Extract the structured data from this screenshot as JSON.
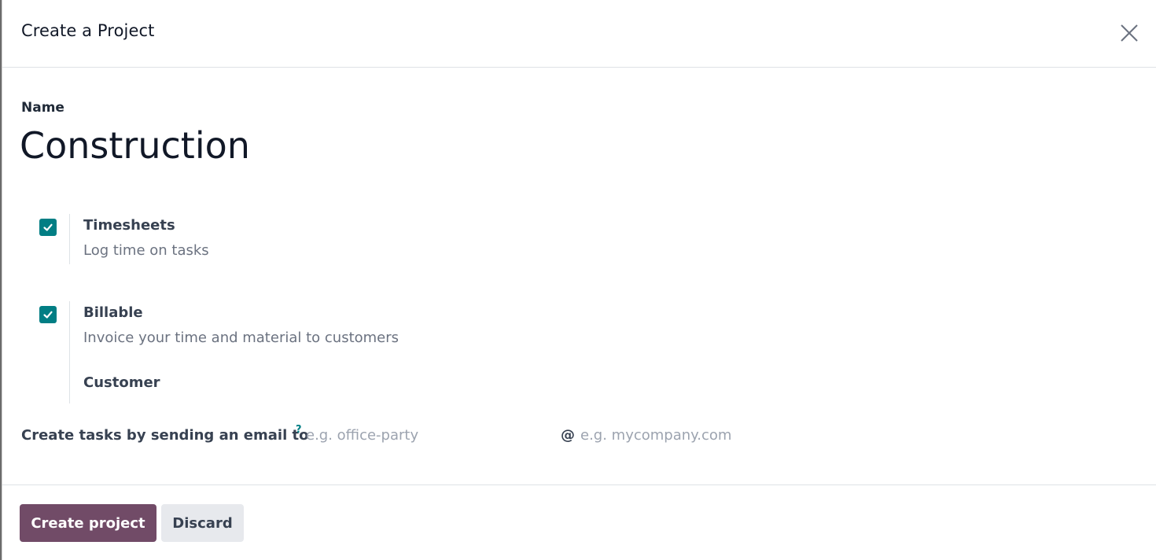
{
  "dialog": {
    "title": "Create a Project",
    "close_icon": "close-icon"
  },
  "name_field": {
    "label": "Name",
    "value": "Construction"
  },
  "options": [
    {
      "title": "Timesheets",
      "description": "Log time on tasks",
      "checked": true
    },
    {
      "title": "Billable",
      "description": "Invoice your time and material to customers",
      "checked": true,
      "sub_field_label": "Customer"
    }
  ],
  "email": {
    "label": "Create tasks by sending an email to",
    "help_mark": "?",
    "alias_placeholder": "e.g. office-party",
    "at_sign": "@",
    "domain_placeholder": "e.g. mycompany.com"
  },
  "footer": {
    "create_label": "Create project",
    "discard_label": "Discard"
  },
  "colors": {
    "accent_teal": "#017e84",
    "primary_button": "#714b67",
    "secondary_button": "#e7e9ed"
  }
}
